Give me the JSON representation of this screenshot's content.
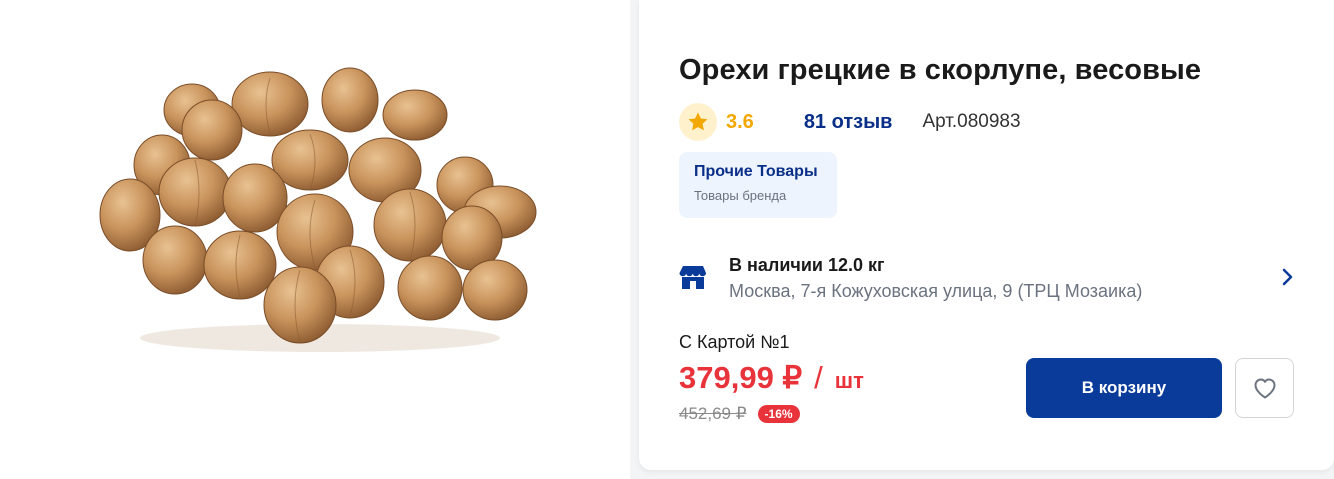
{
  "product": {
    "title": "Орехи грецкие в скорлупе, весовые",
    "image_alt": "walnuts-photo",
    "rating": "3.6",
    "reviews": "81 отзыв",
    "article": "Арт.080983"
  },
  "brand": {
    "name": "Прочие Товары",
    "subtitle": "Товары бренда"
  },
  "availability": {
    "status": "В наличии 12.0 кг",
    "address": "Москва, 7-я Кожуховская улица, 9 (ТРЦ Мозаика)",
    "icon": "store-icon"
  },
  "pricing": {
    "card_label": "С Картой №1",
    "price": "379,99 ₽",
    "separator": "/",
    "unit": "шт",
    "old_price": "452,69 ₽",
    "discount": "-16%"
  },
  "actions": {
    "cart_label": "В корзину",
    "favorite_icon": "heart-icon"
  },
  "colors": {
    "accent_blue": "#0a3a9a",
    "price_red": "#e8333b",
    "rating_gold": "#f2a800",
    "chip_bg": "#eef4fd"
  }
}
